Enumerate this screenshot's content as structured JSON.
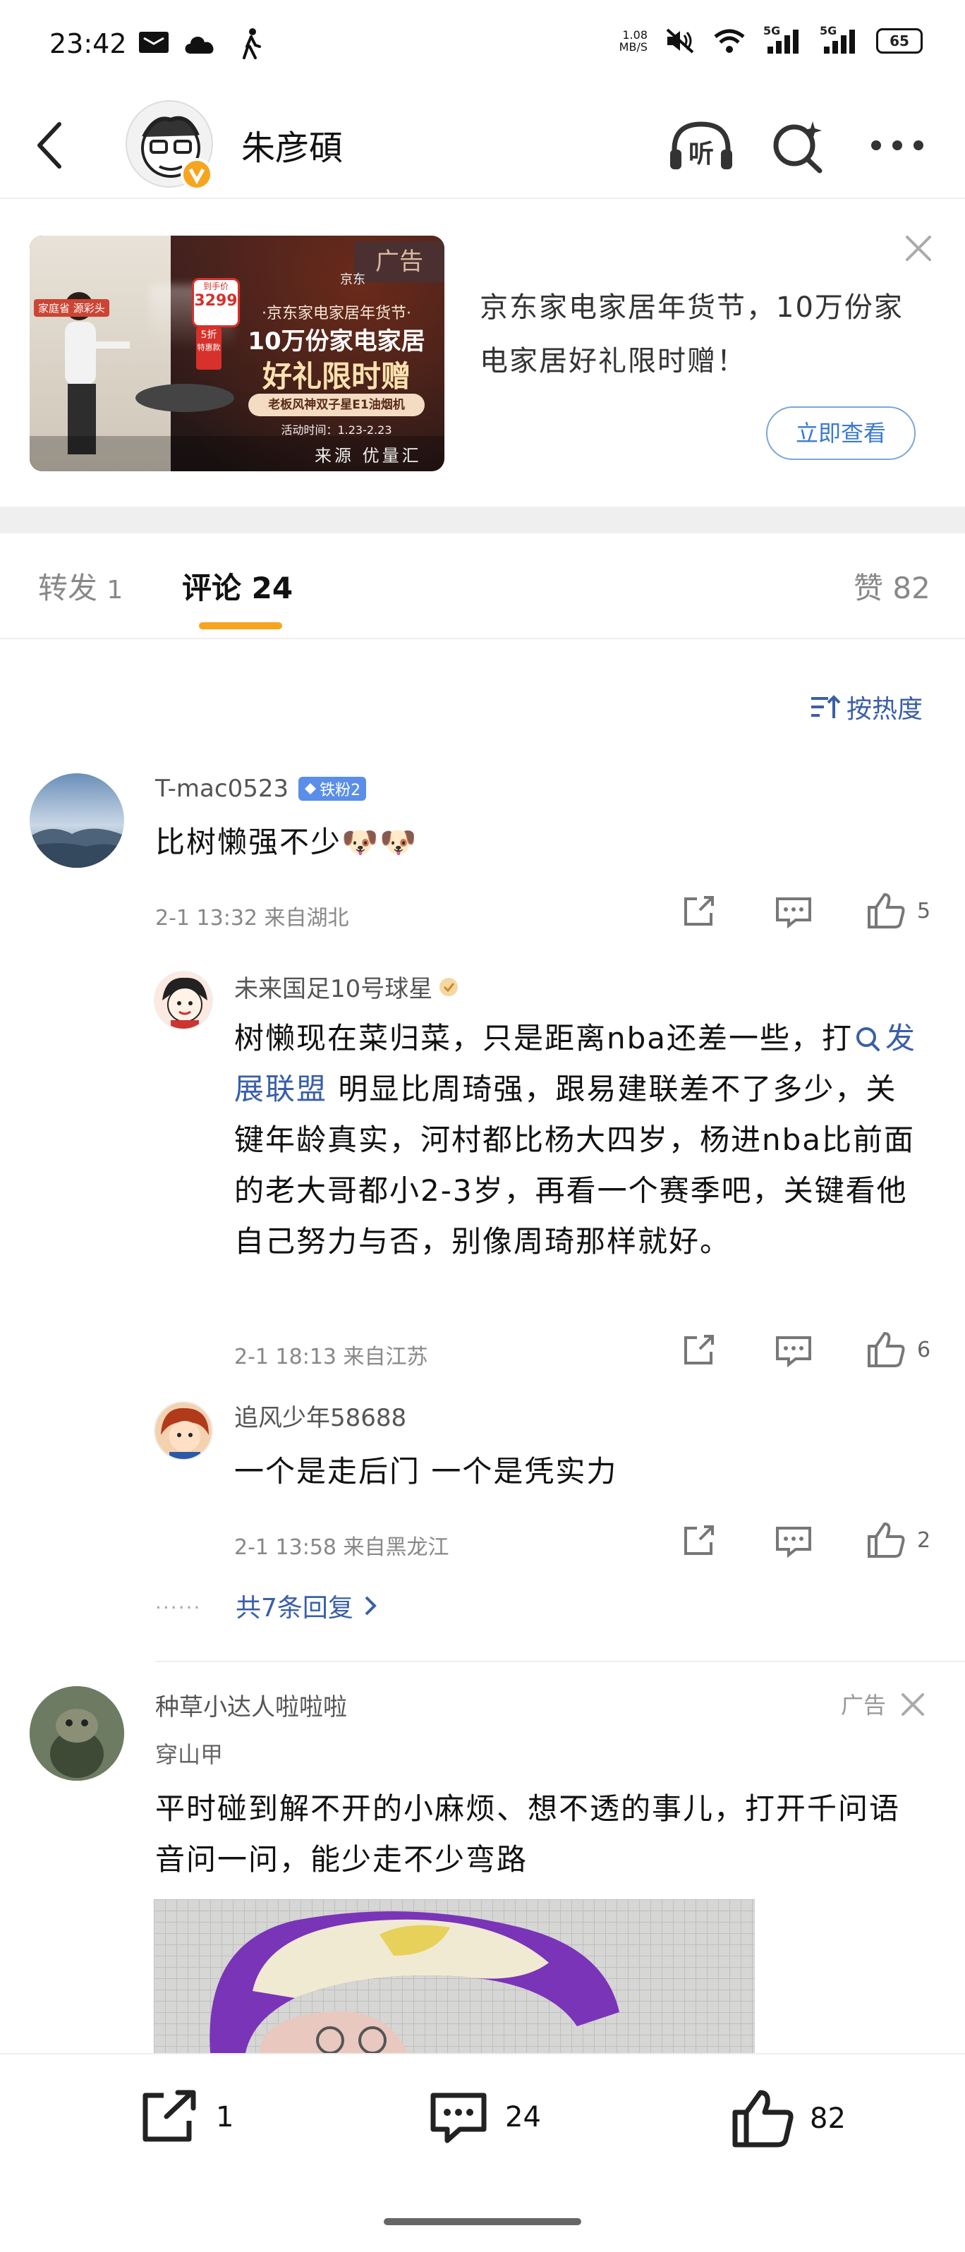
{
  "status_bar": {
    "time": "23:42",
    "net_speed_value": "1.08",
    "net_speed_unit": "MB/S",
    "signal_1": "5G",
    "signal_2": "5G",
    "battery": "65"
  },
  "header": {
    "user_name": "朱彦碩"
  },
  "ad": {
    "banner": {
      "tag": "广告",
      "brand": "京东",
      "left_tag": "家庭省 源彩头",
      "price_label": "到手价",
      "price": "3299",
      "discount": "5折",
      "discount_sub": "特惠款",
      "headline_small": "·京东家电家居年货节·",
      "headline_1": "10万份家电家居",
      "headline_2": "好礼限时赠",
      "product": "老板风神双子星E1油烟机",
      "period": "活动时间：1.23-2.23",
      "source": "来源 优量汇"
    },
    "title": "京东家电家居年货节，10万份家电家居好礼限时赠！",
    "button": "立即查看"
  },
  "tabs": [
    {
      "label": "转发",
      "count": "1"
    },
    {
      "label": "评论",
      "count": "24"
    },
    {
      "label": "赞",
      "count": "82"
    }
  ],
  "sort_label": "按热度",
  "comments": [
    {
      "user": "T-mac0523",
      "badge": "铁粉2",
      "text": "比树懒强不少🐶🐶",
      "time": "2-1 13:32",
      "location": "来自湖北",
      "likes": "5"
    }
  ],
  "replies": [
    {
      "user": "未来国足10号球星",
      "text_before": "树懒现在菜归菜，只是距离nba还差一些，打",
      "link": "发展联盟",
      "text_after": "明显比周琦强，跟易建联差不了多少，关键年龄真实，河村都比杨大四岁，杨进nba比前面的老大哥都小2-3岁，再看一个赛季吧，关键看他自己努力与否，别像周琦那样就好。",
      "time": "2-1 18:13",
      "location": "来自江苏",
      "likes": "6"
    },
    {
      "user": "追风少年58688",
      "text": "一个是走后门 一个是凭实力",
      "time": "2-1 13:58",
      "location": "来自黑龙江",
      "likes": "2"
    }
  ],
  "more_replies": "共7条回复",
  "ad_comment": {
    "user": "种草小达人啦啦啦",
    "tag": "广告",
    "subtitle": "穿山甲",
    "text": "平时碰到解不开的小麻烦、想不透的事儿，打开千问语音问一问，能少走不少弯路"
  },
  "bottom_bar": {
    "repost": "1",
    "comment": "24",
    "like": "82"
  }
}
